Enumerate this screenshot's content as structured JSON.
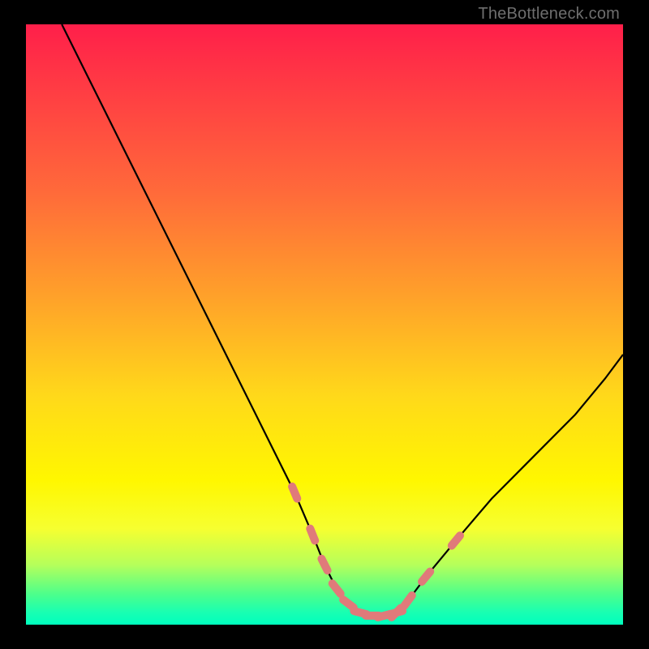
{
  "attribution": "TheBottleneck.com",
  "chart_data": {
    "type": "line",
    "title": "",
    "xlabel": "",
    "ylabel": "",
    "xlim": [
      0,
      100
    ],
    "ylim": [
      0,
      100
    ],
    "grid": false,
    "legend": false,
    "series": [
      {
        "name": "curve",
        "color": "#000000",
        "x": [
          6,
          10,
          15,
          20,
          25,
          30,
          35,
          40,
          45,
          48,
          50,
          52,
          54,
          56,
          58,
          60,
          62,
          64,
          67,
          72,
          78,
          85,
          92,
          97,
          100
        ],
        "y": [
          100,
          92,
          82,
          72,
          62,
          52,
          42,
          32,
          22,
          15,
          10,
          6,
          3.5,
          2,
          1.5,
          1.5,
          2,
          4,
          8,
          14,
          21,
          28,
          35,
          41,
          45
        ]
      },
      {
        "name": "highlight-left",
        "color": "#e07a7a",
        "style": "dotted-segments",
        "x": [
          45,
          48,
          50,
          52,
          54,
          56,
          58,
          60,
          62
        ],
        "y": [
          22,
          15,
          10,
          6,
          3.5,
          2,
          1.5,
          1.5,
          2
        ]
      },
      {
        "name": "highlight-right",
        "color": "#e07a7a",
        "style": "dotted-segments",
        "x": [
          62,
          64,
          67,
          72
        ],
        "y": [
          2,
          4,
          8,
          14
        ]
      }
    ],
    "background_gradient": {
      "direction": "vertical",
      "stops": [
        {
          "pos": 0.0,
          "color": "#ff1f4a"
        },
        {
          "pos": 0.28,
          "color": "#ff6a3a"
        },
        {
          "pos": 0.62,
          "color": "#ffd91a"
        },
        {
          "pos": 0.84,
          "color": "#f6ff30"
        },
        {
          "pos": 0.95,
          "color": "#4bff8c"
        },
        {
          "pos": 1.0,
          "color": "#00ffbe"
        }
      ]
    }
  }
}
